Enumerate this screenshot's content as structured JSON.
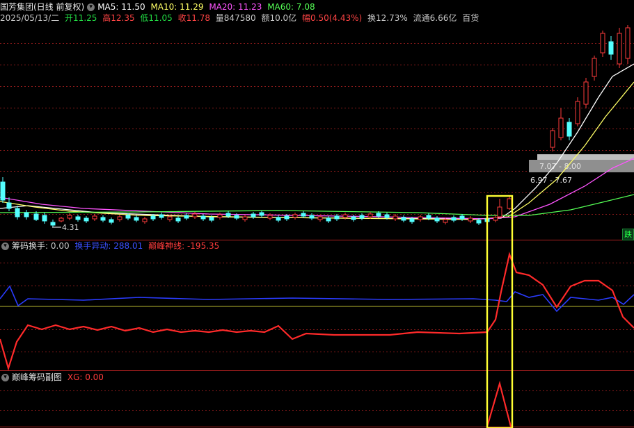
{
  "header": {
    "stock": "国芳集团(日线 前复权)",
    "ma5": "MA5: 11.50",
    "ma10": "MA10: 11.29",
    "ma20": "MA20: 11.23",
    "ma60": "MA60: 7.08",
    "date": "2025/05/13/二",
    "open": "开11.25",
    "high": "高12.35",
    "low": "低11.05",
    "close": "收11.78",
    "volume": "量847580",
    "amount": "额10.0亿",
    "change": "幅0.50(4.43%)",
    "turnover": "换12.73%",
    "float": "流通6.66亿",
    "sector": "百货"
  },
  "price_panel": {
    "min_label": "4.31",
    "range1": "7.07 - 8.00",
    "range2": "6.97 - 7.67",
    "badge": "跌"
  },
  "indicator1": {
    "name": "筹码换手",
    "value": ": 0.00",
    "line1": "换手异动: 288.01",
    "line2": "巅峰神线: -195.35"
  },
  "indicator2": {
    "name": "巅峰筹码副图",
    "xg": "XG: 0.00"
  },
  "colors": {
    "up": "#ff3c3c",
    "down": "#54ffff",
    "ma5": "#ffffff",
    "ma10": "#ffff66",
    "ma20": "#ff55ff",
    "ma60": "#55ff55",
    "highlight": "#ffff33",
    "grid": "#8a1a1a"
  }
}
